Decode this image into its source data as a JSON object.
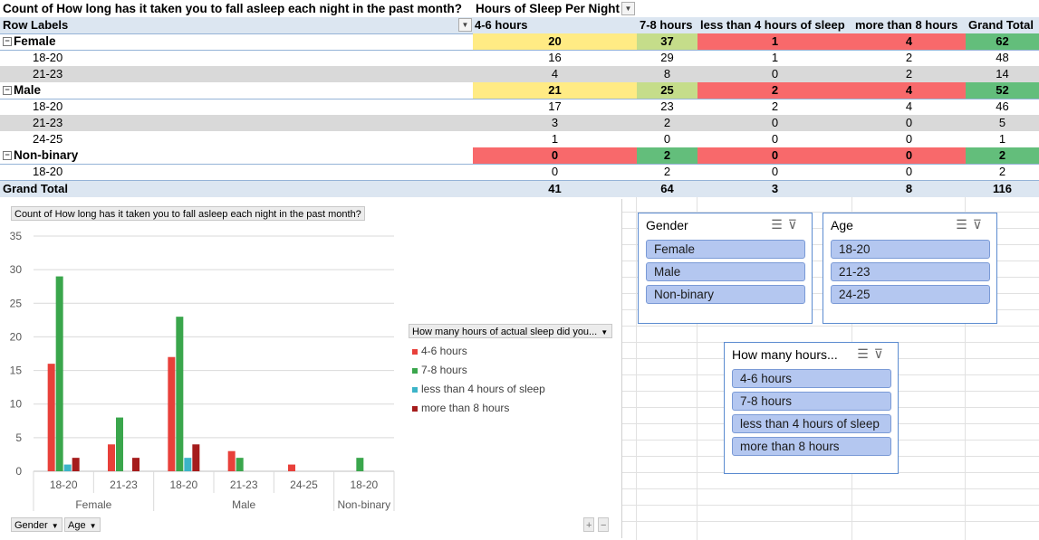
{
  "pivot": {
    "corner_title": "Count of How long has it taken you to fall asleep each night in the past month?",
    "column_field": "Hours of Sleep Per Night",
    "row_labels_header": "Row Labels",
    "columns": [
      "4-6 hours",
      "7-8 hours",
      "less than 4 hours of sleep",
      "more than 8 hours",
      "Grand Total"
    ],
    "rows": [
      {
        "label": "Female",
        "group": true,
        "values": [
          "20",
          "37",
          "1",
          "4",
          "62"
        ]
      },
      {
        "label": "18-20",
        "group": false,
        "values": [
          "16",
          "29",
          "1",
          "2",
          "48"
        ]
      },
      {
        "label": "21-23",
        "group": false,
        "values": [
          "4",
          "8",
          "0",
          "2",
          "14"
        ]
      },
      {
        "label": "Male",
        "group": true,
        "values": [
          "21",
          "25",
          "2",
          "4",
          "52"
        ]
      },
      {
        "label": "18-20",
        "group": false,
        "values": [
          "17",
          "23",
          "2",
          "4",
          "46"
        ]
      },
      {
        "label": "21-23",
        "group": false,
        "values": [
          "3",
          "2",
          "0",
          "0",
          "5"
        ]
      },
      {
        "label": "24-25",
        "group": false,
        "values": [
          "1",
          "0",
          "0",
          "0",
          "1"
        ]
      },
      {
        "label": "Non-binary",
        "group": true,
        "values": [
          "0",
          "2",
          "0",
          "0",
          "2"
        ]
      },
      {
        "label": "18-20",
        "group": false,
        "values": [
          "0",
          "2",
          "0",
          "0",
          "2"
        ]
      }
    ],
    "grand_total": {
      "label": "Grand Total",
      "values": [
        "41",
        "64",
        "3",
        "8",
        "116"
      ]
    },
    "colors": {
      "green": "#63be7b",
      "light_green": "#c5dd8a",
      "yellow": "#ffeb84",
      "red": "#f8696b",
      "band": "#d9d9d9",
      "header_band": "#dce6f1"
    }
  },
  "chart": {
    "title": "Count of How long has it taken you to fall asleep each night in the past month?",
    "legend_title": "How many hours of actual sleep did you...",
    "filter_chips": [
      "Gender",
      "Age"
    ],
    "zoom_buttons": [
      "+",
      "−"
    ]
  },
  "chart_data": {
    "type": "bar",
    "title": "Count of How long has it taken you to fall asleep each night in the past month?",
    "categories": [
      "18-20",
      "21-23",
      "18-20",
      "21-23",
      "24-25",
      "18-20"
    ],
    "groups": [
      {
        "label": "Female",
        "span": 2
      },
      {
        "label": "Male",
        "span": 3
      },
      {
        "label": "Non-binary",
        "span": 1
      }
    ],
    "series": [
      {
        "name": "4-6 hours",
        "color": "#e8403a",
        "values": [
          16,
          4,
          17,
          3,
          1,
          0
        ]
      },
      {
        "name": "7-8 hours",
        "color": "#3aa64c",
        "values": [
          29,
          8,
          23,
          2,
          0,
          2
        ]
      },
      {
        "name": "less than 4 hours of sleep",
        "color": "#3cb4c8",
        "values": [
          1,
          0,
          2,
          0,
          0,
          0
        ]
      },
      {
        "name": "more than 8 hours",
        "color": "#a51c1c",
        "values": [
          2,
          2,
          4,
          0,
          0,
          0
        ]
      }
    ],
    "ylim": [
      0,
      35
    ],
    "yticks": [
      0,
      5,
      10,
      15,
      20,
      25,
      30,
      35
    ],
    "grid": true,
    "legend": "right"
  },
  "slicers": {
    "gender": {
      "title": "Gender",
      "items": [
        "Female",
        "Male",
        "Non-binary"
      ]
    },
    "age": {
      "title": "Age",
      "items": [
        "18-20",
        "21-23",
        "24-25"
      ]
    },
    "hours": {
      "title": "How many hours...",
      "items": [
        "4-6 hours",
        "7-8 hours",
        "less than 4 hours of sleep",
        "more than 8 hours"
      ]
    }
  }
}
